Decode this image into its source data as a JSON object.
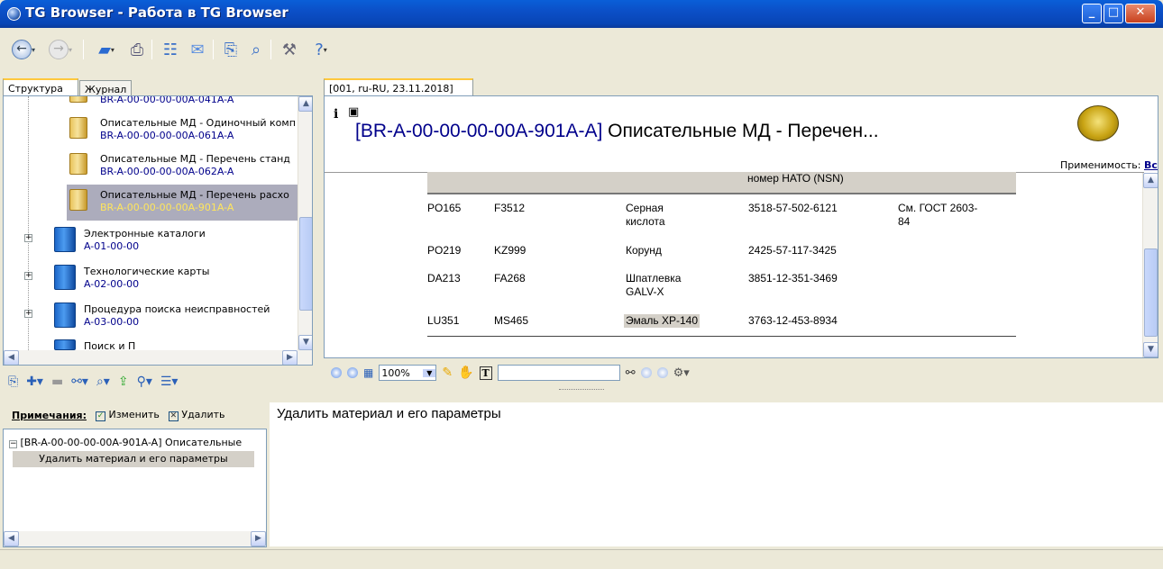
{
  "window": {
    "title": "TG Browser - Работа в TG Browser"
  },
  "left_tabs": [
    "Структура",
    "Журнал"
  ],
  "doc_tab": "[001, ru-RU, 23.11.2018]",
  "tree": [
    {
      "title": "",
      "code": "BR-A-00-00-00-00A-041A-A"
    },
    {
      "title": "Описательные МД - Одиночный комп",
      "code": "BR-A-00-00-00-00A-061A-A"
    },
    {
      "title": "Описательные МД - Перечень станд",
      "code": "BR-A-00-00-00-00A-062A-A"
    },
    {
      "title": "Описательные МД - Перечень расхо",
      "code": "BR-A-00-00-00-00A-901A-A"
    },
    {
      "title": "Электронные каталоги",
      "code": "A-01-00-00"
    },
    {
      "title": "Технологические карты",
      "code": "A-02-00-00"
    },
    {
      "title": "Процедура поиска неисправностей",
      "code": "A-03-00-00"
    },
    {
      "title": "Поиск и П",
      "code": ""
    }
  ],
  "document": {
    "title_code": "[BR-A-00-00-00-00A-901A-A]",
    "title_text": " Описательные МД - Перечен...",
    "applicability_label": "Применимость:",
    "applicability_value": "Все",
    "header_partial": "номер НАТО (NSN)",
    "rows": [
      [
        "PO165",
        "F3512",
        "Серная\nкислота",
        "3518-57-502-6121",
        "См. ГОСТ 2603-\n84"
      ],
      [
        "PO219",
        "KZ999",
        "Корунд",
        "2425-57-117-3425",
        ""
      ],
      [
        "DA213",
        "FA268",
        "Шпатлевка\nGALV-X",
        "3851-12-351-3469",
        ""
      ],
      [
        "LU351",
        "MS465",
        "Эмаль ХР-140",
        "3763-12-453-8934",
        ""
      ]
    ]
  },
  "viewer_toolbar": {
    "zoom": "100%",
    "search_value": ""
  },
  "notes": {
    "label": "Примечания:",
    "edit_label": "Изменить",
    "delete_label": "Удалить",
    "tree_item": "[BR-A-00-00-00-00A-901A-A] Описательные",
    "sub_item": "Удалить материал и его параметры",
    "detail_text": "Удалить материал и его параметры"
  },
  "colors": {
    "title_bar": "#0a5fd8",
    "selection": "#acacbc",
    "code_link": "#00008b"
  }
}
